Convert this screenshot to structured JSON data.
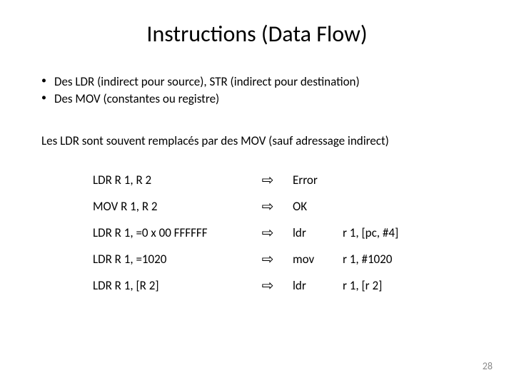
{
  "title": "Instructions (Data Flow)",
  "bullets": [
    "Des LDR (indirect pour source), STR (indirect pour destination)",
    "Des MOV (constantes ou registre)"
  ],
  "body_text": "Les LDR sont souvent remplacés par des MOV (sauf adressage indirect)",
  "arrow": "⇨",
  "table": [
    {
      "instr": "LDR R 1, R 2",
      "result": "Error",
      "args": ""
    },
    {
      "instr": "MOV R 1, R 2",
      "result": "OK",
      "args": ""
    },
    {
      "instr": "LDR R 1, =0 x 00 FFFFFF",
      "result": "ldr",
      "args": "r 1, [pc, #4]"
    },
    {
      "instr": "LDR R 1, =1020",
      "result": "mov",
      "args": "r 1, #1020"
    },
    {
      "instr": "LDR R 1, [R 2]",
      "result": "ldr",
      "args": "r 1, [r 2]"
    }
  ],
  "page_number": "28"
}
